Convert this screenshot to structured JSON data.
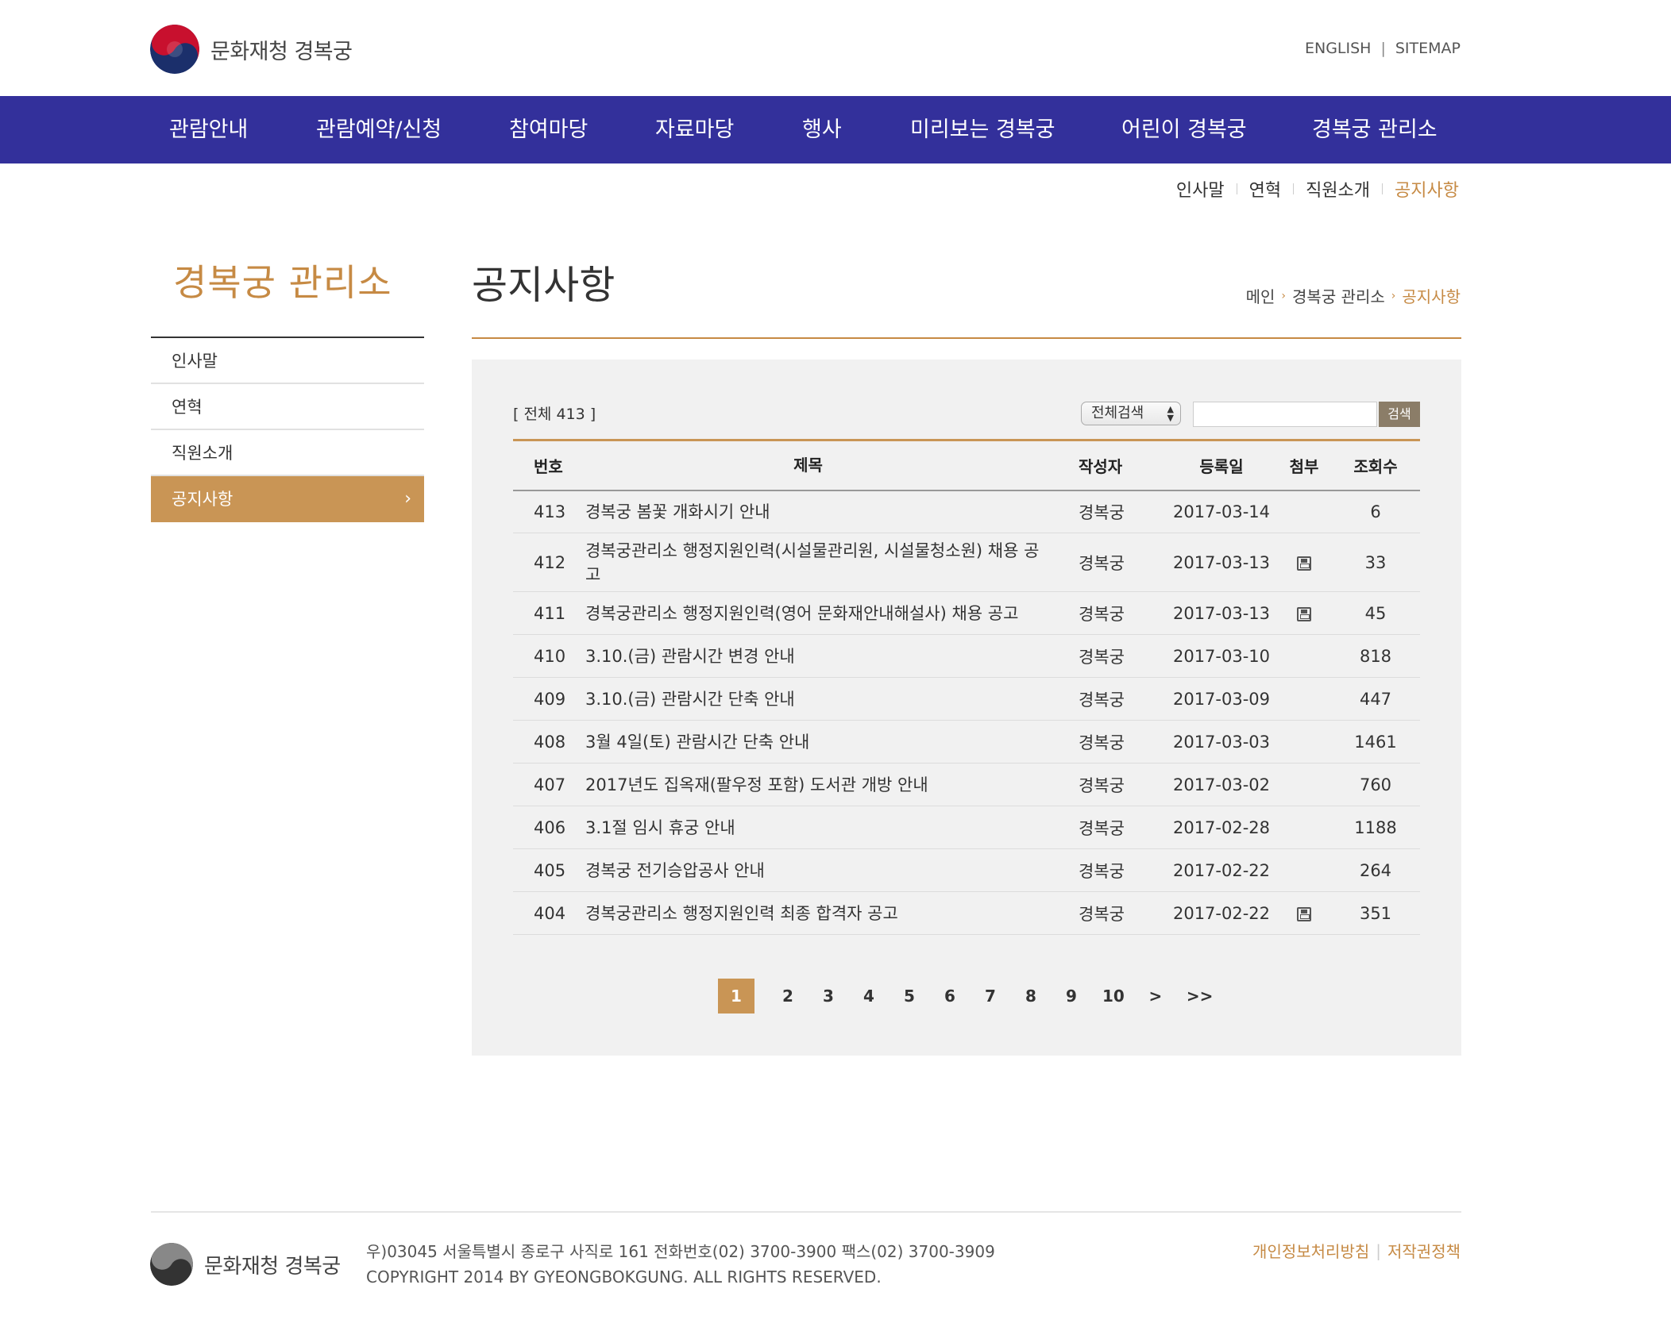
{
  "header": {
    "logo_text": "문화재청 경복궁",
    "top_links": [
      "ENGLISH",
      "SITEMAP"
    ]
  },
  "gnb": [
    "관람안내",
    "관람예약/신청",
    "참여마당",
    "자료마당",
    "행사",
    "미리보는 경복궁",
    "어린이 경복궁",
    "경복궁 관리소"
  ],
  "subnav": [
    "인사말",
    "연혁",
    "직원소개",
    "공지사항"
  ],
  "sidebar": {
    "title": "경복궁 관리소",
    "items": [
      "인사말",
      "연혁",
      "직원소개",
      "공지사항"
    ],
    "active_arrow": "›"
  },
  "content": {
    "page_title": "공지사항",
    "breadcrumb": [
      "메인",
      "경복궁 관리소",
      "공지사항"
    ]
  },
  "board": {
    "total": "[ 전체 413 ]",
    "search_select": "전체검색",
    "search_button": "검색",
    "headers": {
      "num": "번호",
      "title": "제목",
      "writer": "작성자",
      "date": "등록일",
      "file": "첨부",
      "hits": "조회수"
    },
    "rows": [
      {
        "num": "413",
        "title": "경복궁 봄꽃 개화시기 안내",
        "writer": "경복궁",
        "date": "2017-03-14",
        "file": false,
        "hits": "6"
      },
      {
        "num": "412",
        "title": "경복궁관리소 행정지원인력(시설물관리원, 시설물청소원) 채용 공고",
        "writer": "경복궁",
        "date": "2017-03-13",
        "file": true,
        "hits": "33"
      },
      {
        "num": "411",
        "title": "경복궁관리소 행정지원인력(영어 문화재안내해설사) 채용 공고",
        "writer": "경복궁",
        "date": "2017-03-13",
        "file": true,
        "hits": "45"
      },
      {
        "num": "410",
        "title": "3.10.(금) 관람시간 변경 안내",
        "writer": "경복궁",
        "date": "2017-03-10",
        "file": false,
        "hits": "818"
      },
      {
        "num": "409",
        "title": "3.10.(금) 관람시간 단축 안내",
        "writer": "경복궁",
        "date": "2017-03-09",
        "file": false,
        "hits": "447"
      },
      {
        "num": "408",
        "title": "3월 4일(토) 관람시간 단축 안내",
        "writer": "경복궁",
        "date": "2017-03-03",
        "file": false,
        "hits": "1461"
      },
      {
        "num": "407",
        "title": "2017년도 집옥재(팔우정 포함) 도서관 개방 안내",
        "writer": "경복궁",
        "date": "2017-03-02",
        "file": false,
        "hits": "760"
      },
      {
        "num": "406",
        "title": "3.1절 임시 휴궁 안내",
        "writer": "경복궁",
        "date": "2017-02-28",
        "file": false,
        "hits": "1188"
      },
      {
        "num": "405",
        "title": "경복궁 전기승압공사 안내",
        "writer": "경복궁",
        "date": "2017-02-22",
        "file": false,
        "hits": "264"
      },
      {
        "num": "404",
        "title": "경복궁관리소 행정지원인력 최종 합격자 공고",
        "writer": "경복궁",
        "date": "2017-02-22",
        "file": true,
        "hits": "351"
      }
    ],
    "file_icon": "floppy-disk-icon"
  },
  "pagination": {
    "pages": [
      "1",
      "2",
      "3",
      "4",
      "5",
      "6",
      "7",
      "8",
      "9",
      "10"
    ],
    "active": "1",
    "next": ">",
    "last": ">>"
  },
  "footer": {
    "logo_text": "문화재청 경복궁",
    "address": "우)03045 서울특별시 종로구 사직로 161 전화번호(02) 3700-3900 팩스(02) 3700-3909",
    "copyright": "COPYRIGHT 2014 BY GYEONGBOKGUNG. ALL RIGHTS RESERVED.",
    "links": [
      "개인정보처리방침",
      "저작권정책"
    ]
  },
  "colors": {
    "nav_bg": "#33309b",
    "accent": "#c68a44",
    "active_menu": "#c99555"
  }
}
